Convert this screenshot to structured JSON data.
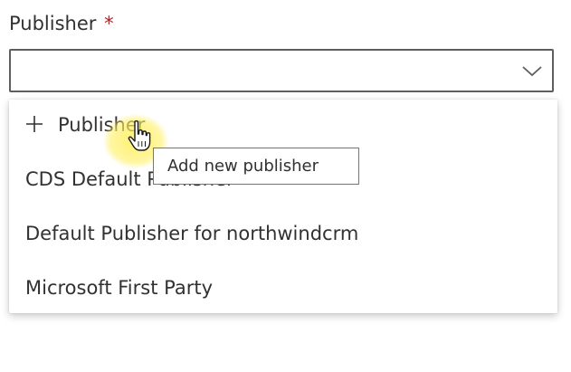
{
  "field": {
    "label": "Publisher",
    "required_marker": "*",
    "value": ""
  },
  "dropdown": {
    "add_option": {
      "icon": "plus-icon",
      "label": "Publisher"
    },
    "options": [
      "CDS Default Publisher",
      "Default Publisher for northwindcrm",
      "Microsoft First Party"
    ]
  },
  "tooltip": {
    "text": "Add new publisher"
  },
  "colors": {
    "required": "#a4262c",
    "text": "#323130",
    "border": "#605e5c",
    "cursor_highlight": "#ffee50"
  }
}
